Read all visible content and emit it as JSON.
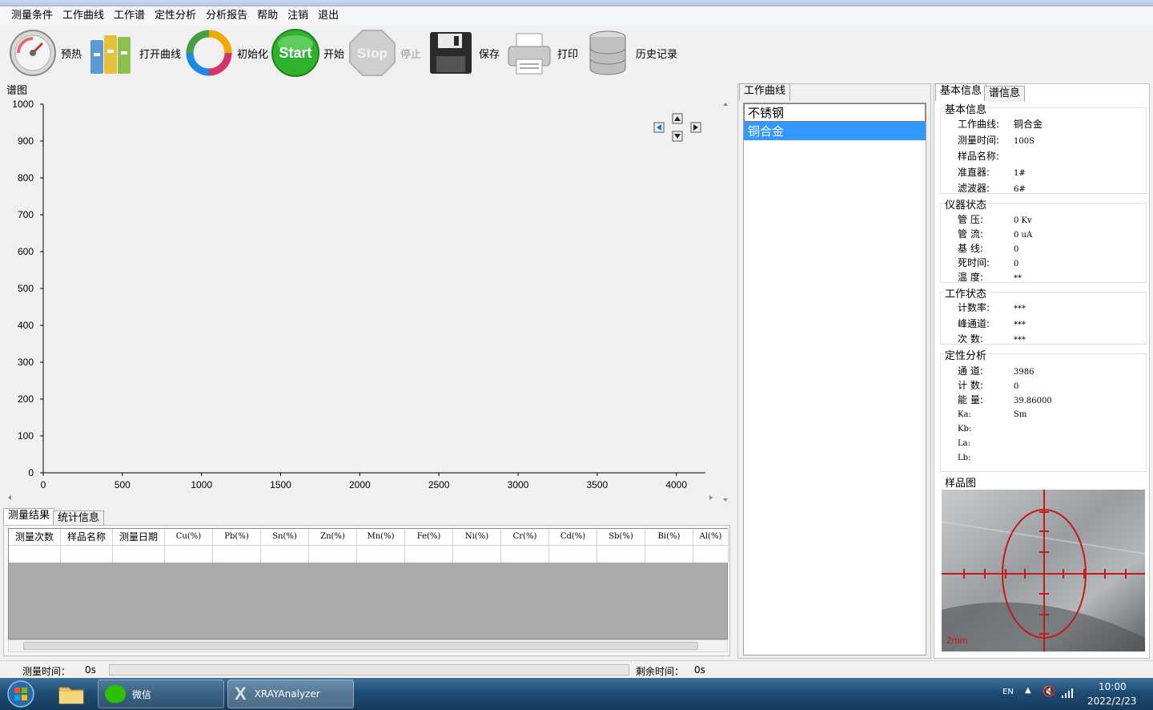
{
  "menu": [
    "测量条件",
    "工作曲线",
    "工作谱",
    "定性分析",
    "分析报告",
    "帮助",
    "注销",
    "退出"
  ],
  "toolbar": {
    "preheat": "预热",
    "open_curve": "打开曲线",
    "init": "初始化",
    "start_icon_text": "Start",
    "start": "开始",
    "stop_icon_text": "Stop",
    "stop": "停止",
    "save": "保存",
    "print": "打印",
    "history": "历史记录"
  },
  "spectrum": {
    "label": "谱图",
    "y_ticks": [
      "1000",
      "900",
      "800",
      "700",
      "600",
      "500",
      "400",
      "300",
      "200",
      "100",
      "0"
    ],
    "x_ticks": [
      "0",
      "500",
      "1000",
      "1500",
      "2000",
      "2500",
      "3000",
      "3500",
      "4000"
    ]
  },
  "chart_data": {
    "type": "line",
    "title": "谱图",
    "xlabel": "",
    "ylabel": "",
    "xlim": [
      0,
      4100
    ],
    "ylim": [
      0,
      1000
    ],
    "x_ticks": [
      0,
      500,
      1000,
      1500,
      2000,
      2500,
      3000,
      3500,
      4000
    ],
    "y_ticks": [
      0,
      100,
      200,
      300,
      400,
      500,
      600,
      700,
      800,
      900,
      1000
    ],
    "series": [],
    "grid": false
  },
  "bottom_tabs": [
    "测量结果",
    "统计信息"
  ],
  "results": {
    "columns": [
      "测量次数",
      "样品名称",
      "测量日期",
      "Cu(%)",
      "Pb(%)",
      "Sn(%)",
      "Zn(%)",
      "Mn(%)",
      "Fe(%)",
      "Ni(%)",
      "Cr(%)",
      "Cd(%)",
      "Sb(%)",
      "Bi(%)",
      "Al(%)"
    ]
  },
  "work_curve": {
    "tab": "工作曲线",
    "items": [
      "不锈钢",
      "铜合金"
    ],
    "selected": 1
  },
  "info_tabs": [
    "基本信息",
    "谱信息"
  ],
  "basic_info": {
    "title": "基本信息",
    "rows": [
      {
        "k": "工作曲线:",
        "v": "铜合金"
      },
      {
        "k": "测量时间:",
        "v": "100S"
      },
      {
        "k": "样品名称:",
        "v": ""
      },
      {
        "k": "准直器:",
        "v": "1#"
      },
      {
        "k": "滤波器:",
        "v": "6#"
      }
    ]
  },
  "instrument": {
    "title": "仪器状态",
    "rows": [
      {
        "k": "管  压:",
        "v": "0 Kv"
      },
      {
        "k": "管  流:",
        "v": "0 uA"
      },
      {
        "k": "基  线:",
        "v": "0"
      },
      {
        "k": "死时间:",
        "v": "0"
      },
      {
        "k": "温  度:",
        "v": "**"
      }
    ]
  },
  "work_status": {
    "title": "工作状态",
    "rows": [
      {
        "k": "计数率:",
        "v": "***"
      },
      {
        "k": "峰通道:",
        "v": "***"
      },
      {
        "k": "次  数:",
        "v": "***"
      }
    ]
  },
  "qualitative": {
    "title": "定性分析",
    "rows": [
      {
        "k": "通  道:",
        "v": "3986"
      },
      {
        "k": "计  数:",
        "v": "0"
      },
      {
        "k": "能  量:",
        "v": "39.86000"
      },
      {
        "k": "Ka:",
        "v": "Sm"
      },
      {
        "k": "Kb:",
        "v": ""
      },
      {
        "k": "La:",
        "v": ""
      },
      {
        "k": "Lb:",
        "v": ""
      }
    ]
  },
  "sample_image": {
    "title": "样品图",
    "scale_label": "2mm"
  },
  "status": {
    "measure_time_label": "测量时间：",
    "measure_time_value": "0s",
    "remain_label": "剩余时间：",
    "remain_value": "0s"
  },
  "taskbar": {
    "wechat": "微信",
    "app": "XRAYAnalyzer",
    "lang": "EN",
    "time": "10:00",
    "date": "2022/2/23"
  },
  "colors": {
    "selection": "#3399ff",
    "crosshair": "#cc1a1a",
    "start_green": "#2fb32f",
    "taskbar": "#1d4a72"
  }
}
